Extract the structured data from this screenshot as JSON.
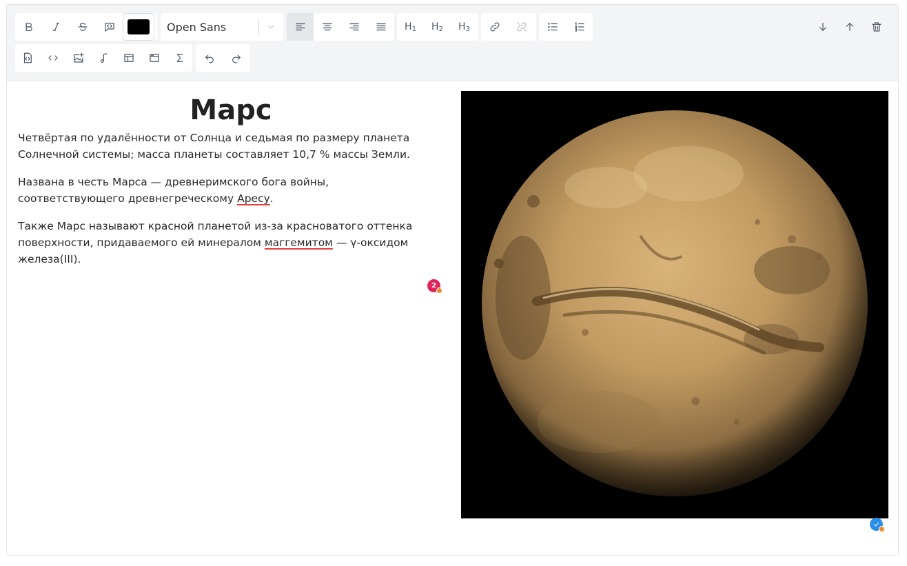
{
  "toolbar": {
    "font_family": "Open Sans",
    "text_color": "#000000",
    "heading_buttons": [
      {
        "label": "H",
        "level": "1"
      },
      {
        "label": "H",
        "level": "2"
      },
      {
        "label": "H",
        "level": "3"
      }
    ]
  },
  "document": {
    "title": "Марс",
    "paragraphs": {
      "p1": "Четвёртая по удалённости от Солнца и седьмая по размеру планета Солнечной системы; масса планеты составляет 10,7 % массы Земли.",
      "p2_before": "Названа в честь Марса — древнеримского бога войны, соответствующего древнегреческому ",
      "p2_misspelled": "Аресу",
      "p2_after": ".",
      "p3_before": "Также Марс называют красной планетой из-за красноватого оттенка поверхности, придаваемого ей минералом ",
      "p3_misspelled": "маггемитом",
      "p3_after": " — γ-оксидом железа(III)."
    }
  },
  "status": {
    "issue_count": "2",
    "error_color": "#e1245a",
    "ok_color": "#2b8fe8"
  },
  "image": {
    "subject": "planet Mars globe"
  }
}
